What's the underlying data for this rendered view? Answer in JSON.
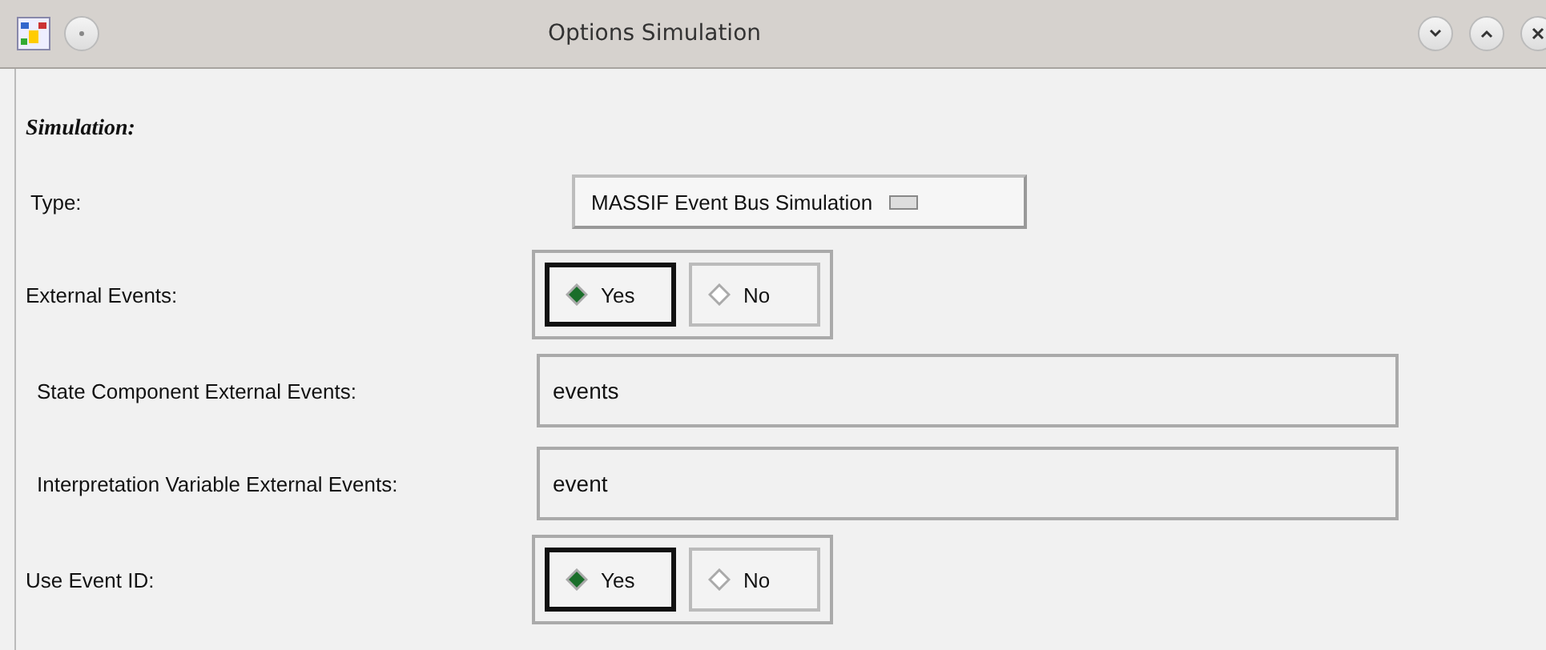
{
  "window": {
    "title": "Options Simulation"
  },
  "section": {
    "title": "Simulation:"
  },
  "rows": [
    {
      "kind": "dropdown",
      "label": "Type:",
      "value": "MASSIF Event Bus Simulation"
    },
    {
      "kind": "radio",
      "label": "External Events:",
      "options": [
        {
          "label": "Yes",
          "selected": true
        },
        {
          "label": "No",
          "selected": false
        }
      ]
    },
    {
      "kind": "text",
      "label": "State Component External Events:",
      "value": "events"
    },
    {
      "kind": "text",
      "label": "Interpretation Variable External Events:",
      "value": "event"
    },
    {
      "kind": "radio",
      "label": "Use Event ID:",
      "options": [
        {
          "label": "Yes",
          "selected": true
        },
        {
          "label": "No",
          "selected": false
        }
      ]
    }
  ]
}
